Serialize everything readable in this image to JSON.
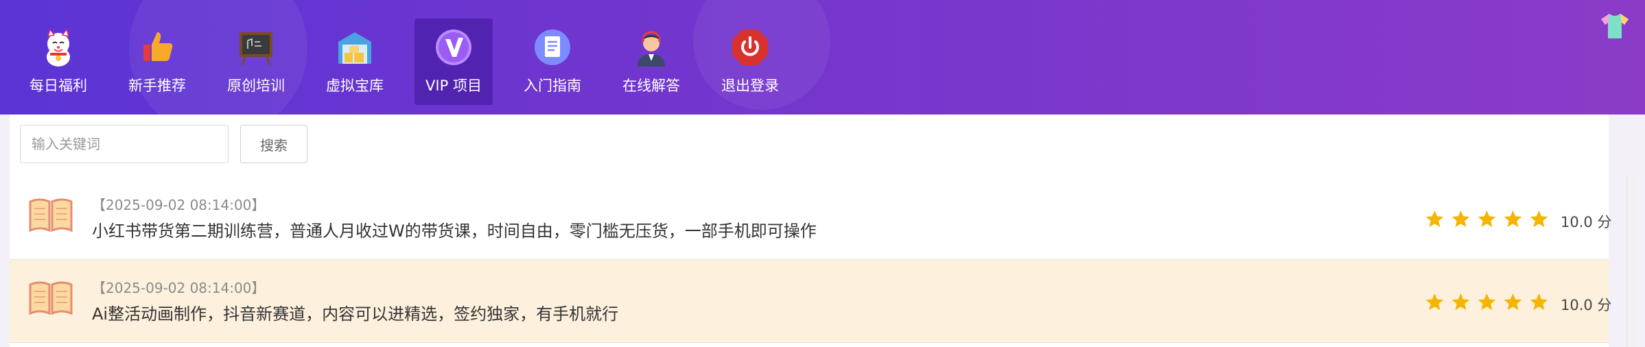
{
  "nav": {
    "items": [
      {
        "label": "每日福利",
        "icon": "lucky-cat-icon"
      },
      {
        "label": "新手推荐",
        "icon": "thumbs-up-icon"
      },
      {
        "label": "原创培训",
        "icon": "chalkboard-icon"
      },
      {
        "label": "虚拟宝库",
        "icon": "warehouse-icon"
      },
      {
        "label": "VIP 项目",
        "icon": "vip-icon",
        "active": true
      },
      {
        "label": "入门指南",
        "icon": "document-icon"
      },
      {
        "label": "在线解答",
        "icon": "support-agent-icon"
      },
      {
        "label": "退出登录",
        "icon": "power-icon"
      }
    ]
  },
  "search": {
    "placeholder": "输入关键词",
    "value": "",
    "button_label": "搜索"
  },
  "list": {
    "items": [
      {
        "date": "【2025-09-02 08:14:00】",
        "title": "小红书带货第二期训练营，普通人月收过W的带货课，时间自由，零门槛无压货，一部手机即可操作",
        "rating": 5,
        "score": "10.0 分",
        "highlighted": false
      },
      {
        "date": "【2025-09-02 08:14:00】",
        "title": "Ai整活动画制作，抖音新赛道，内容可以进精选，签约独家，有手机就行",
        "rating": 5,
        "score": "10.0 分",
        "highlighted": true
      }
    ]
  },
  "colors": {
    "header_gradient_start": "#5b34d6",
    "header_gradient_end": "#8b3bc8",
    "star": "#f5b400",
    "highlight_row": "#fdf1dd"
  }
}
